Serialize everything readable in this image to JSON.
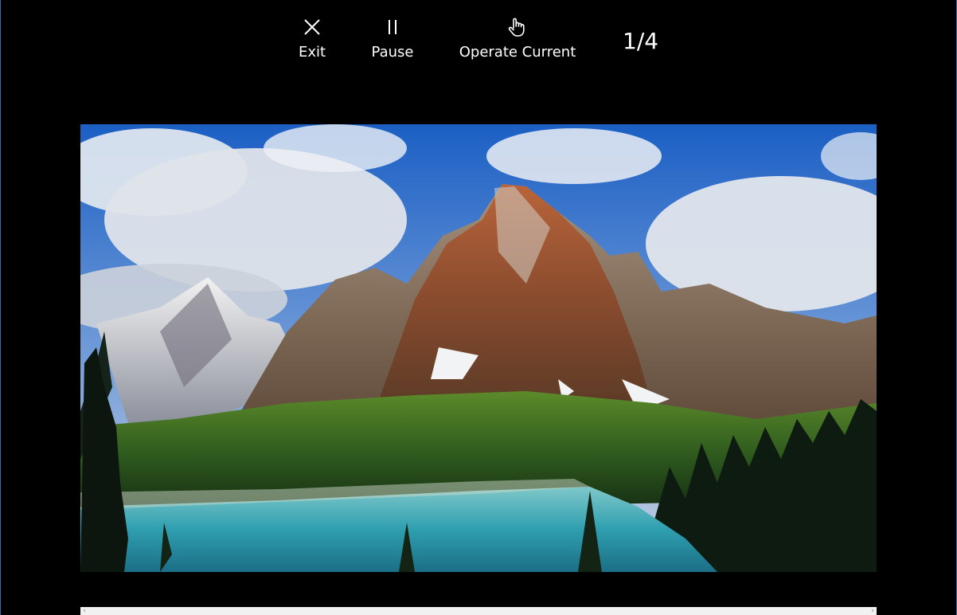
{
  "toolbar": {
    "exit_label": "Exit",
    "pause_label": "Pause",
    "operate_label": "Operate Current",
    "counter": "1/4"
  },
  "slideshow": {
    "current": 1,
    "total": 4,
    "image_alt": "mountain-lake-landscape"
  },
  "colors": {
    "background": "#000000",
    "text": "#ffffff",
    "window_border": "#3a6ea5"
  }
}
